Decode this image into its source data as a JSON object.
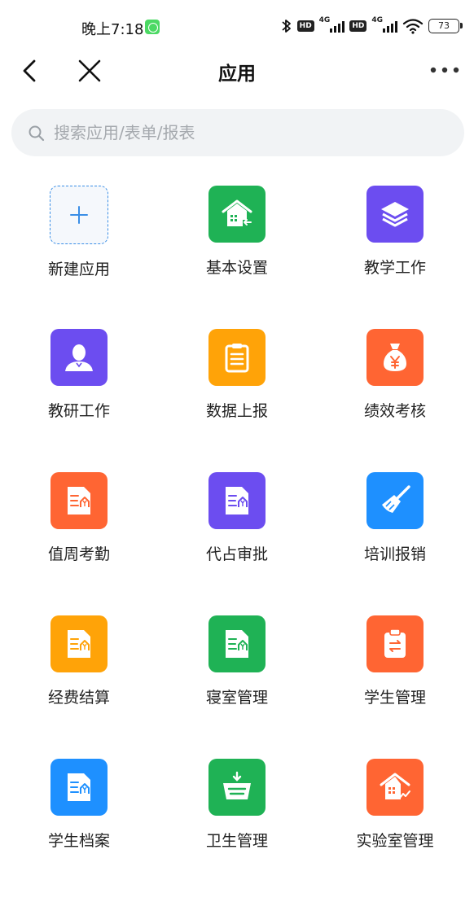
{
  "status": {
    "time": "晚上7:18",
    "hd1": "HD",
    "net1": "4G",
    "hd2": "HD",
    "net2": "4G",
    "battery": "73"
  },
  "nav": {
    "title": "应用"
  },
  "search": {
    "placeholder": "搜索应用/表单/报表"
  },
  "apps": [
    {
      "label": "新建应用",
      "icon": "plus-icon",
      "color": "#f5f8fc"
    },
    {
      "label": "基本设置",
      "icon": "building-settings-icon",
      "color": "#1fb255"
    },
    {
      "label": "教学工作",
      "icon": "layers-icon",
      "color": "#6c4df0"
    },
    {
      "label": "教研工作",
      "icon": "person-icon",
      "color": "#6c4df0"
    },
    {
      "label": "数据上报",
      "icon": "clipboard-icon",
      "color": "#ffa308"
    },
    {
      "label": "绩效考核",
      "icon": "money-bag-icon",
      "color": "#ff6533"
    },
    {
      "label": "值周考勤",
      "icon": "expense-doc-icon",
      "color": "#ff6533"
    },
    {
      "label": "代占审批",
      "icon": "expense-doc-icon",
      "color": "#6c4df0"
    },
    {
      "label": "培训报销",
      "icon": "broom-icon",
      "color": "#1e90ff"
    },
    {
      "label": "经费结算",
      "icon": "expense-doc-icon",
      "color": "#ffa308"
    },
    {
      "label": "寝室管理",
      "icon": "expense-doc-icon",
      "color": "#1fb255"
    },
    {
      "label": "学生管理",
      "icon": "transfer-clipboard-icon",
      "color": "#ff6533"
    },
    {
      "label": "学生档案",
      "icon": "expense-doc-icon",
      "color": "#1e90ff"
    },
    {
      "label": "卫生管理",
      "icon": "basket-icon",
      "color": "#1fb255"
    },
    {
      "label": "实验室管理",
      "icon": "building-chart-icon",
      "color": "#ff6533"
    }
  ]
}
